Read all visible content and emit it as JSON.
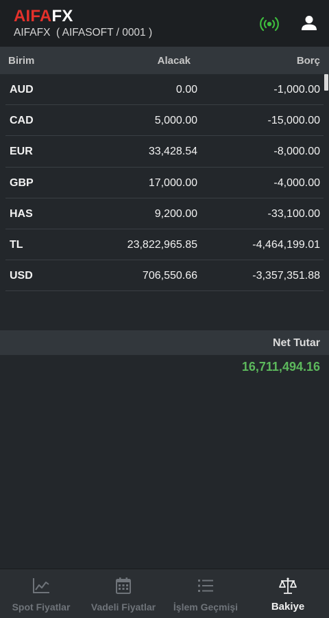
{
  "header": {
    "logo_part1": "AIFA",
    "logo_part2": "FX",
    "subtitle": "AIFAFX  ( AIFASOFT / 0001 )",
    "signal_icon": "signal-broadcast-icon",
    "signal_color": "#3dbb3d",
    "user_icon": "user-icon"
  },
  "table": {
    "columns": [
      "Birim",
      "Alacak",
      "Borç"
    ],
    "rows": [
      {
        "currency": "AUD",
        "alacak": "0.00",
        "borc": "-1,000.00"
      },
      {
        "currency": "CAD",
        "alacak": "5,000.00",
        "borc": "-15,000.00"
      },
      {
        "currency": "EUR",
        "alacak": "33,428.54",
        "borc": "-8,000.00"
      },
      {
        "currency": "GBP",
        "alacak": "17,000.00",
        "borc": "-4,000.00"
      },
      {
        "currency": "HAS",
        "alacak": "9,200.00",
        "borc": "-33,100.00"
      },
      {
        "currency": "TL",
        "alacak": "23,822,965.85",
        "borc": "-4,464,199.01"
      },
      {
        "currency": "USD",
        "alacak": "706,550.66",
        "borc": "-3,357,351.88"
      }
    ]
  },
  "net": {
    "label": "Net Tutar",
    "value": "16,711,494.16",
    "value_color": "#5cb85c"
  },
  "nav": {
    "items": [
      {
        "label": "Spot Fiyatlar",
        "icon": "line-chart-icon",
        "active": false
      },
      {
        "label": "Vadeli Fiyatlar",
        "icon": "calendar-icon",
        "active": false
      },
      {
        "label": "İşlem Geçmişi",
        "icon": "list-icon",
        "active": false
      },
      {
        "label": "Bakiye",
        "icon": "balance-scale-icon",
        "active": true
      }
    ]
  },
  "colors": {
    "brand_red": "#e4312b",
    "background": "#23272b",
    "header_bar": "#32373c"
  }
}
